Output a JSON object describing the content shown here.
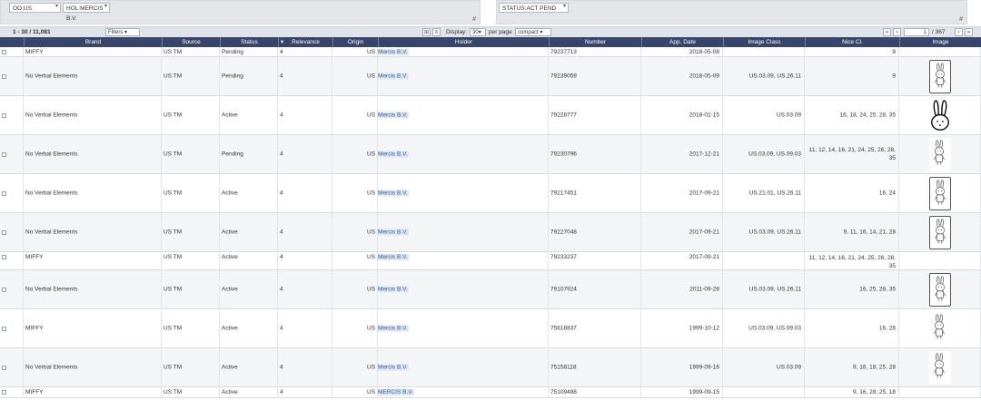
{
  "filters": {
    "left_chips": [
      {
        "label": "OO:US"
      },
      {
        "label": "HOL:MERCIS B.V."
      }
    ],
    "right_chips": [
      {
        "label": "STATUS:ACT PEND"
      }
    ],
    "hash_marker": "#"
  },
  "toolbar": {
    "range": "1 - 30 / 11,081",
    "filters_select": "Filters",
    "display_label": "Display:",
    "display_value": "30",
    "per_page_label": "per page",
    "view_select": "compact",
    "page_value": "1",
    "page_total": "/ 367"
  },
  "columns": {
    "brand": "Brand",
    "source": "Source",
    "status": "Status",
    "relevance": "Relevance",
    "origin": "Origin",
    "holder": "Holder",
    "number": "Number",
    "app_date": "App. Date",
    "image_class": "Image Class",
    "nice_cl": "Nice Cl.",
    "image": "Image"
  },
  "rows": [
    {
      "brand": "MIFFY",
      "source": "US TM",
      "status": "Pending",
      "relevance": "4",
      "origin": "US",
      "holder": "Mercis B.V.",
      "number": "79237713",
      "app_date": "2018-05-08",
      "image_class": "",
      "nice_cl": "9",
      "image": "none",
      "small": true
    },
    {
      "brand": "No Verbal Elements",
      "source": "US TM",
      "status": "Pending",
      "relevance": "4",
      "origin": "US",
      "holder": "Mercis B.V.",
      "number": "79239059",
      "app_date": "2018-05-09",
      "image_class": "US.03.09, US.26.11",
      "nice_cl": "9",
      "image": "framed-rabbit"
    },
    {
      "brand": "No Verbal Elements",
      "source": "US TM",
      "status": "Active",
      "relevance": "4",
      "origin": "US",
      "holder": "Mercis B.V.",
      "number": "79228777",
      "app_date": "2018-01-15",
      "image_class": "US.03.09",
      "nice_cl": "16, 18, 24, 25, 28, 35",
      "image": "rabbit-head"
    },
    {
      "brand": "No Verbal Elements",
      "source": "US TM",
      "status": "Pending",
      "relevance": "4",
      "origin": "US",
      "holder": "Mercis B.V.",
      "number": "79230796",
      "app_date": "2017-12-21",
      "image_class": "US.03.09, US.09.03",
      "nice_cl": "11, 12, 14, 16, 21, 24, 25, 26, 28, 35",
      "image": "rabbit"
    },
    {
      "brand": "No Verbal Elements",
      "source": "US TM",
      "status": "Active",
      "relevance": "4",
      "origin": "US",
      "holder": "Mercis B.V.",
      "number": "79217451",
      "app_date": "2017-09-21",
      "image_class": "US.21.01, US.26.11",
      "nice_cl": "16, 24",
      "image": "framed-rabbit"
    },
    {
      "brand": "No Verbal Elements",
      "source": "US TM",
      "status": "Active",
      "relevance": "4",
      "origin": "US",
      "holder": "Mercis B.V.",
      "number": "79227048",
      "app_date": "2017-09-21",
      "image_class": "US.03.09, US.26.11",
      "nice_cl": "9, 11, 16, 14, 21, 28",
      "image": "framed-rabbit"
    },
    {
      "brand": "MIFFY",
      "source": "US TM",
      "status": "Active",
      "relevance": "4",
      "origin": "US",
      "holder": "Mercis B.V.",
      "number": "79233237",
      "app_date": "2017-09-21",
      "image_class": "",
      "nice_cl": "11, 12, 14, 16, 21, 24, 25, 26, 28, 35",
      "image": "none",
      "small": true
    },
    {
      "brand": "No Verbal Elements",
      "source": "US TM",
      "status": "Active",
      "relevance": "4",
      "origin": "US",
      "holder": "Mercis B.V.",
      "number": "79107924",
      "app_date": "2011-09-28",
      "image_class": "US.03.09, US.26.11",
      "nice_cl": "16, 25, 28, 35",
      "image": "framed-rabbit"
    },
    {
      "brand": "MIFFY",
      "source": "US TM",
      "status": "Active",
      "relevance": "4",
      "origin": "US",
      "holder": "Mercis B.V.",
      "number": "75618837",
      "app_date": "1999-10-12",
      "image_class": "US.03.09, US.09.03",
      "nice_cl": "16, 28",
      "image": "rabbit"
    },
    {
      "brand": "No Verbal Elements",
      "source": "US TM",
      "status": "Active",
      "relevance": "4",
      "origin": "US",
      "holder": "Mercis B.V.",
      "number": "75158118",
      "app_date": "1999-09-16",
      "image_class": "US.03.09",
      "nice_cl": "9, 16, 18, 25, 28",
      "image": "rabbit"
    },
    {
      "brand": "MIFFY",
      "source": "US TM",
      "status": "Active",
      "relevance": "4",
      "origin": "US",
      "holder": "MERCIS B.V.",
      "number": "75109488",
      "app_date": "1999-09-15",
      "image_class": "",
      "nice_cl": "9, 16, 28, 25, 18",
      "image": "none",
      "small": true
    }
  ]
}
